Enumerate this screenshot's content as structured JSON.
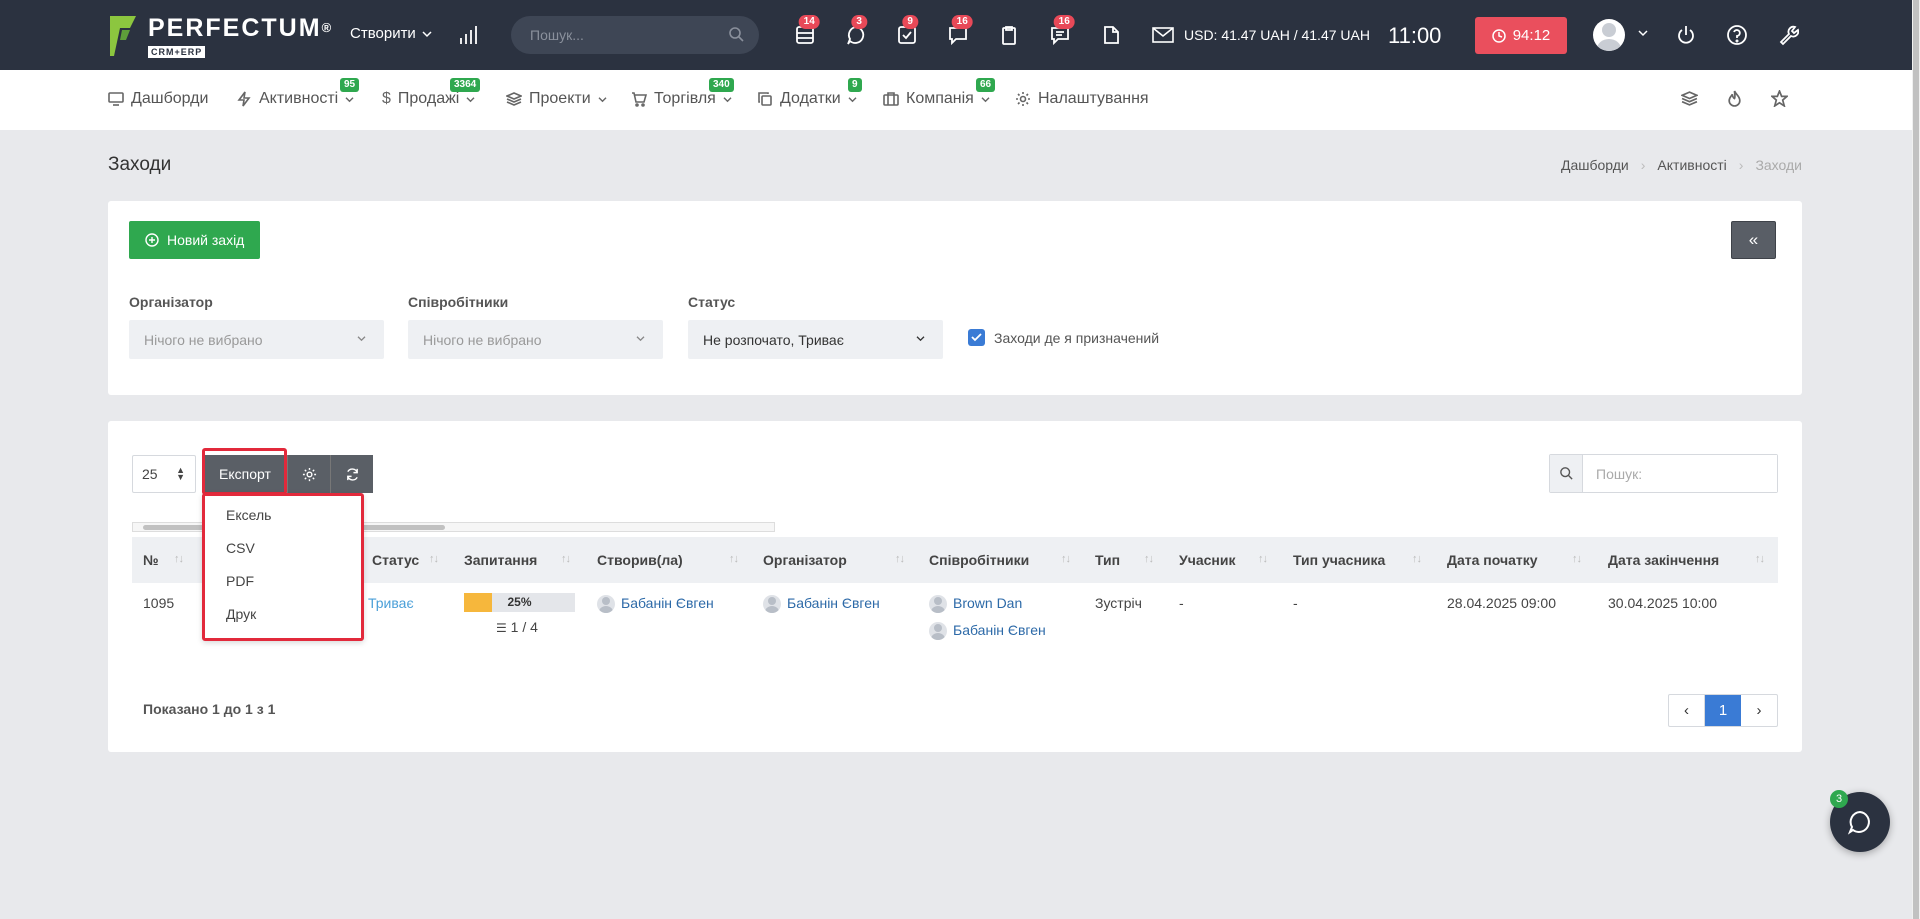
{
  "app": {
    "logo_text": "PERFECTUM",
    "logo_reg": "®",
    "logo_sub": "CRM+ERP",
    "accent_green": "#2fa84f",
    "accent_red": "#e84958"
  },
  "topbar": {
    "create_label": "Створити",
    "search_placeholder": "Пошук...",
    "icons": [
      {
        "name": "database-icon",
        "badge": "14"
      },
      {
        "name": "chat-bubble-icon",
        "badge": "3"
      },
      {
        "name": "task-check-icon",
        "badge": "9"
      },
      {
        "name": "messages-icon",
        "badge": "16"
      },
      {
        "name": "clipboard-icon",
        "badge": ""
      },
      {
        "name": "comments-icon",
        "badge": "16"
      },
      {
        "name": "document-icon",
        "badge": ""
      }
    ],
    "currency_text": "USD: 41.47 UAH / 41.47 UAH",
    "clock": "11:00",
    "timer": "94:12"
  },
  "nav": {
    "items": [
      {
        "label": "Дашборди",
        "badge": ""
      },
      {
        "label": "Активності",
        "badge": "95"
      },
      {
        "label": "Продажі",
        "badge": "3364"
      },
      {
        "label": "Проекти",
        "badge": ""
      },
      {
        "label": "Торгівля",
        "badge": "340"
      },
      {
        "label": "Додатки",
        "badge": "9"
      },
      {
        "label": "Компанія",
        "badge": "66"
      },
      {
        "label": "Налаштування",
        "badge": ""
      }
    ]
  },
  "page": {
    "title": "Заходи",
    "breadcrumb": [
      "Дашборди",
      "Активності",
      "Заходи"
    ]
  },
  "filters": {
    "new_button": "Новий захід",
    "collapse_label": "«",
    "organizer_label": "Організатор",
    "organizer_value": "Нічого не вибрано",
    "employees_label": "Співробітники",
    "employees_value": "Нічого не вибрано",
    "status_label": "Статус",
    "status_value": "Не розпочато, Триває",
    "assigned_checkbox_label": "Заходи де я призначений"
  },
  "table": {
    "page_length": "25",
    "export_label": "Експорт",
    "export_menu": [
      "Ексель",
      "CSV",
      "PDF",
      "Друк"
    ],
    "search_placeholder": "Пошук:",
    "columns": [
      "№",
      "Статус",
      "Запитання",
      "Створив(ла)",
      "Організатор",
      "Співробітники",
      "Тип",
      "Учасник",
      "Тип учасника",
      "Дата початку",
      "Дата закінчення"
    ],
    "rows": [
      {
        "number": "1095",
        "status": "Триває",
        "progress_percent": "25%",
        "progress_fraction": 0.25,
        "questions": "1 / 4",
        "creator": "Бабанін Євген",
        "organizer": "Бабанін Євген",
        "employees": [
          "Brown Dan",
          "Бабанін Євген"
        ],
        "type": "Зустріч",
        "participant": "-",
        "participant_type": "-",
        "start_date": "28.04.2025 09:00",
        "end_date": "30.04.2025 10:00"
      }
    ],
    "info": "Показано 1 до 1 з 1",
    "pager": {
      "prev": "‹",
      "current": "1",
      "next": "›"
    }
  },
  "chat": {
    "badge": "3"
  }
}
